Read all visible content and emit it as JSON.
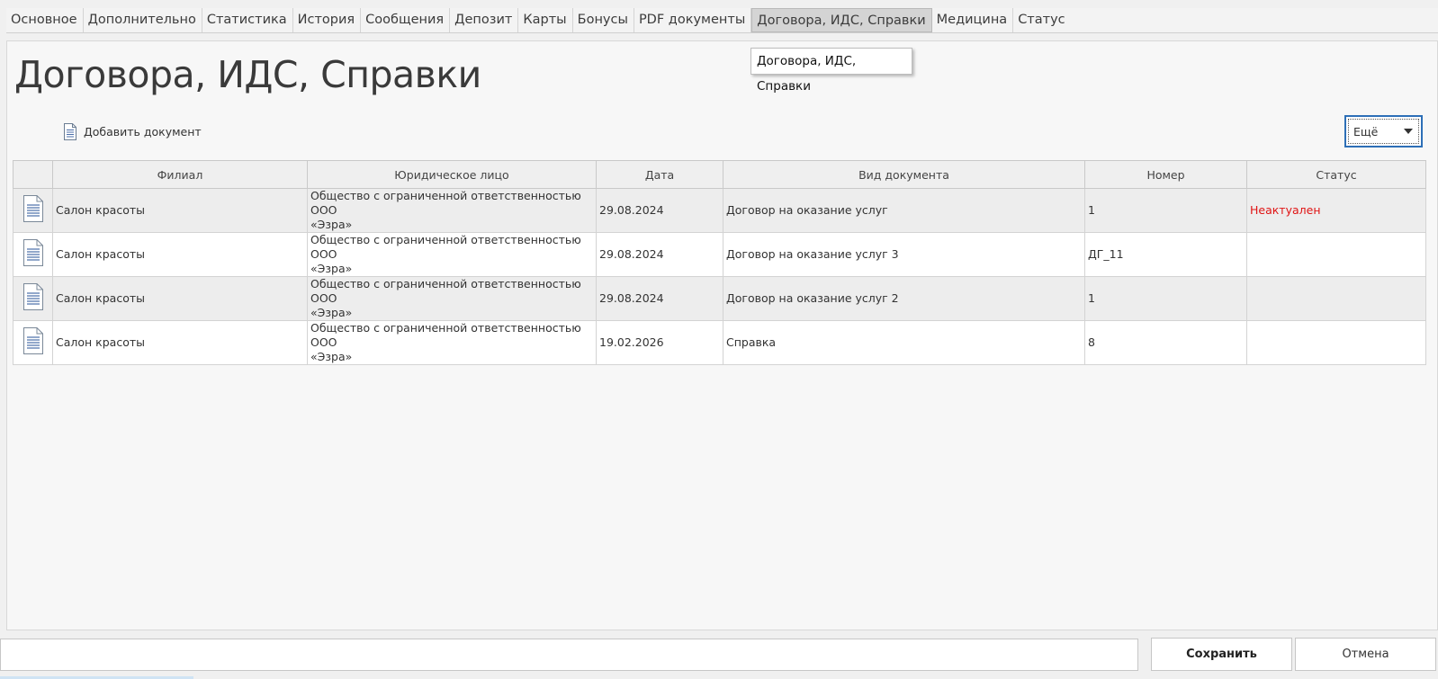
{
  "tabs": [
    {
      "label": "Основное"
    },
    {
      "label": "Дополнительно"
    },
    {
      "label": "Статистика"
    },
    {
      "label": "История"
    },
    {
      "label": "Сообщения"
    },
    {
      "label": "Депозит"
    },
    {
      "label": "Карты"
    },
    {
      "label": "Бонусы"
    },
    {
      "label": "PDF документы"
    },
    {
      "label": "Договора, ИДС, Справки",
      "active": true
    },
    {
      "label": "Медицина"
    },
    {
      "label": "Статус"
    }
  ],
  "page": {
    "title": "Договора, ИДС, Справки",
    "tooltip": "Договора, ИДС, Справки"
  },
  "toolbar": {
    "add_document": "Добавить документ",
    "add_document_icon": "document-icon",
    "more_label": "Ещё"
  },
  "table": {
    "columns": [
      "",
      "Филиал",
      "Юридическое лицо",
      "Дата",
      "Вид документа",
      "Номер",
      "Статус"
    ],
    "rows": [
      {
        "branch": "Салон красоты",
        "entity_line1": "Общество с ограниченной ответственностью ООО",
        "entity_line2": "«Эзра»",
        "date": "29.08.2024",
        "doc_type": "Договор на оказание услуг",
        "number": "1",
        "status": "Неактуален"
      },
      {
        "branch": "Салон красоты",
        "entity_line1": "Общество с ограниченной ответственностью ООО",
        "entity_line2": "«Эзра»",
        "date": "29.08.2024",
        "doc_type": "Договор на оказание услуг 3",
        "number": "ДГ_11",
        "status": ""
      },
      {
        "branch": "Салон красоты",
        "entity_line1": "Общество с ограниченной ответственностью ООО",
        "entity_line2": "«Эзра»",
        "date": "29.08.2024",
        "doc_type": "Договор на оказание услуг 2",
        "number": "1",
        "status": ""
      },
      {
        "branch": "Салон красоты",
        "entity_line1": "Общество с ограниченной ответственностью ООО",
        "entity_line2": "«Эзра»",
        "date": "19.02.2026",
        "doc_type": "Справка",
        "number": "8",
        "status": ""
      }
    ]
  },
  "footer": {
    "save_label": "Сохранить",
    "cancel_label": "Отмена"
  },
  "colors": {
    "status_inactive": "#e01414",
    "focus_border": "#2d6fb7"
  }
}
